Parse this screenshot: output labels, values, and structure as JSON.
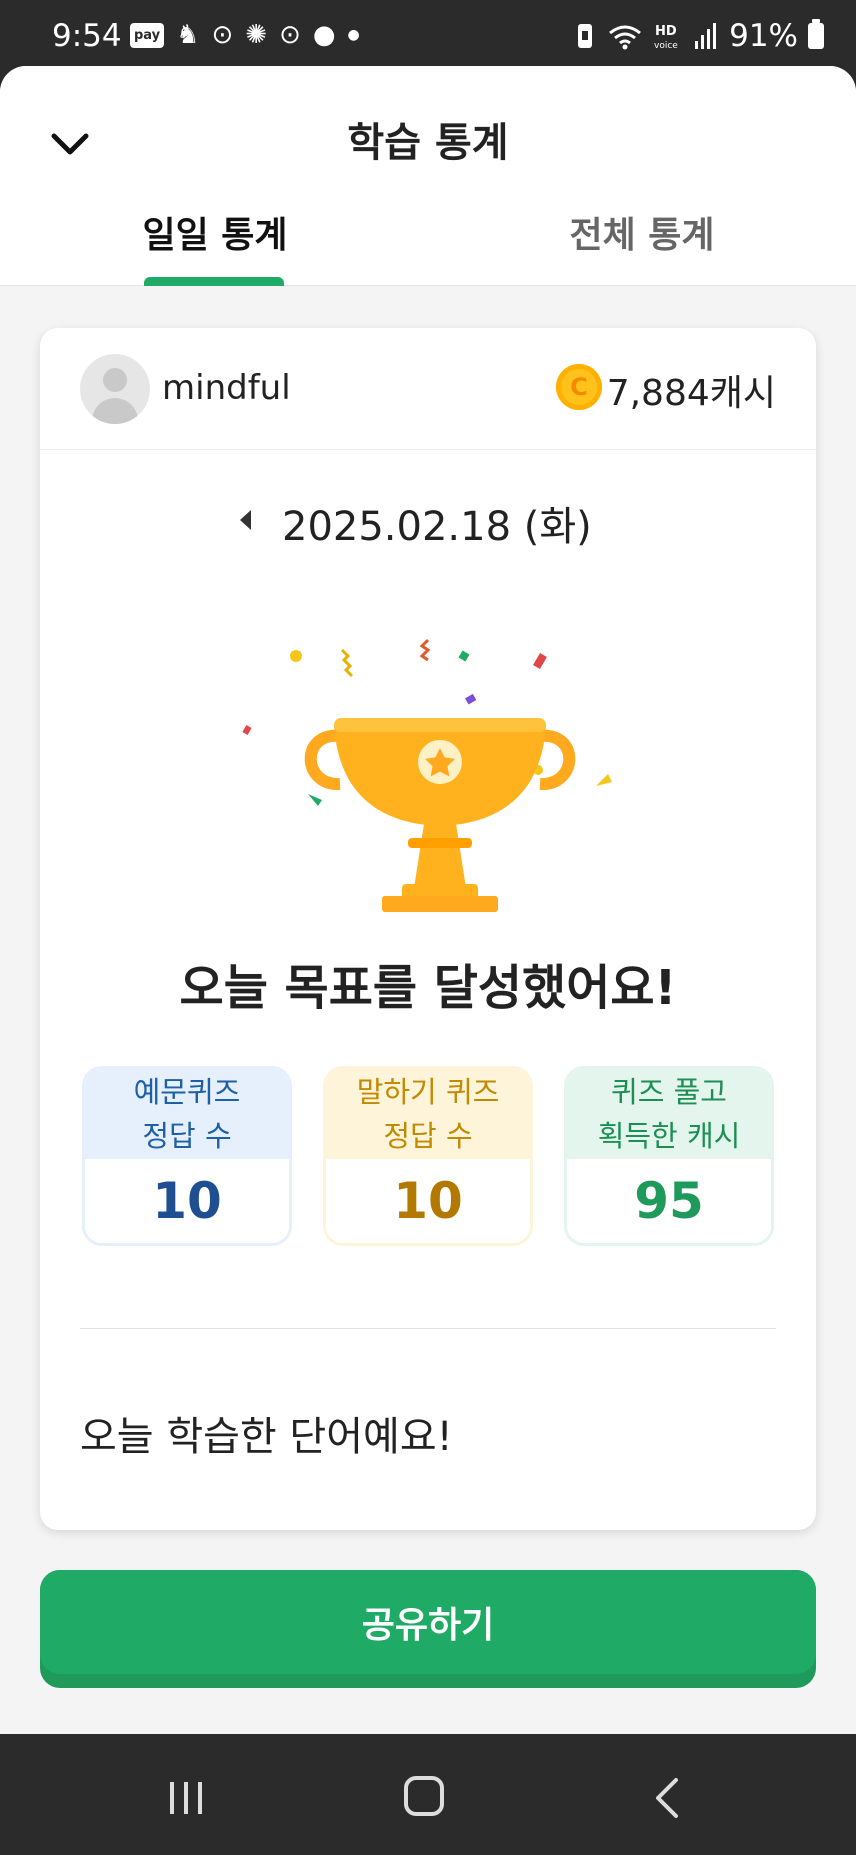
{
  "status_bar": {
    "time": "9:54",
    "pay_label": "pay",
    "battery": "91%",
    "icons": [
      "pay-icon",
      "app-icon",
      "vibration-icon",
      "wifi-icon",
      "hd-voice-icon",
      "signal-icon",
      "battery-icon"
    ]
  },
  "header": {
    "title": "학습 통계",
    "close_icon": "chevron-down-icon",
    "tabs": [
      {
        "label": "일일 통계",
        "active": true
      },
      {
        "label": "전체 통계",
        "active": false
      }
    ],
    "accent_color": "#1faa66"
  },
  "profile": {
    "username": "mindful",
    "coin_symbol": "C",
    "cash": "7,884캐시"
  },
  "date": {
    "text": "2025.02.18 (화)"
  },
  "goal_message": "오늘 목표를 달성했어요!",
  "stats": [
    {
      "line1": "예문퀴즈",
      "line2": "정답 수",
      "value": "10",
      "color": "#1f4f90"
    },
    {
      "line1": "말하기 퀴즈",
      "line2": "정답 수",
      "value": "10",
      "color": "#b37800"
    },
    {
      "line1": "퀴즈 풀고",
      "line2": "획득한 캐시",
      "value": "95",
      "color": "#1f9a5a"
    }
  ],
  "words_title": "오늘 학습한 단어예요!",
  "share_button": "공유하기",
  "nav": {
    "icons": [
      "recent-apps-icon",
      "home-icon",
      "back-icon"
    ]
  }
}
